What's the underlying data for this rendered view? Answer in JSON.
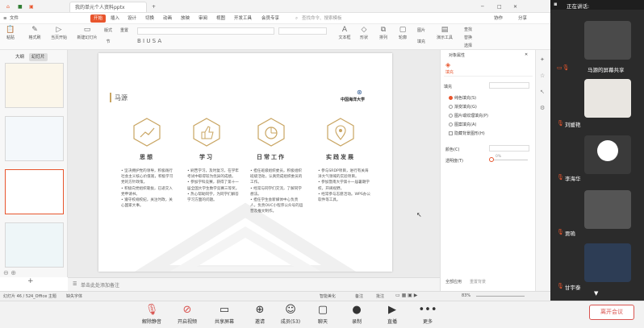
{
  "window": {
    "tabs": [
      "",
      "我的单元个人资料pptx",
      ""
    ],
    "share_banner": "正在讲话:"
  },
  "menu": {
    "items": [
      "文件",
      "开始",
      "插入",
      "设计",
      "切换",
      "动画",
      "放映",
      "审阅",
      "视图",
      "开发工具",
      "会员专享"
    ],
    "active": "开始",
    "search": "查找命令、搜索模板",
    "right": [
      "协作",
      "分享"
    ]
  },
  "ribbon": {
    "groups": [
      "粘贴",
      "格式刷",
      "当页开始",
      "新建幻灯片",
      "版式",
      "节",
      "重置",
      "文本框",
      "形状",
      "排列",
      "轮廓",
      "图片",
      "填充",
      "演示工具",
      "查找",
      "替换",
      "选择"
    ]
  },
  "left": {
    "tabs": [
      "大纲",
      "幻灯片"
    ],
    "slides": [
      "",
      "",
      "",
      "",
      ""
    ]
  },
  "slide": {
    "header": "马源",
    "logo": "中国海洋大学",
    "columns": [
      {
        "title": "思想",
        "text": "• 坚决拥护党的领导，积极践行社会主义核心价值观，积极学习党的方针政策。\n• 积极向党组织靠拢，已递交入党申请书。\n• 遵守校规校纪，关注时政，关心国家大事。"
      },
      {
        "title": "学习",
        "text": "• 刷苦学习，及时复习，在学年考试中取得较为优异的成绩。\n• 参加学科竞赛，获得了第十一届全国大学生数学竞赛三等奖。\n• 热心帮助同学，为同学们解答学习方面的问题。"
      },
      {
        "title": "日常工作",
        "text": "• 担任班级组织委员，积极组织班级活动，认真完成组织委员的工作。\n• 经常与同学们交流，了解同学想法。\n• 担任学生会新媒体中心负责人，负责OUC小程序公众号的运营及推文制作。"
      },
      {
        "title": "实践发展",
        "text": "• 参与SRDP项目，进行有关海洋大气领域的实验项目。\n• 参加暨南大学第十一届暑期学校，开阔视野。\n• 经常参与志愿活动。WPS办公软件等工具。"
      }
    ]
  },
  "rightpane": {
    "title": "对象属性",
    "tab": "填充",
    "section": "填充",
    "options": [
      "纯色填充(S)",
      "渐变填充(G)",
      "图片或纹理填充(P)",
      "图案填充(A)",
      "隐藏背景图形(H)"
    ],
    "color_label": "颜色(C)",
    "transparency_label": "透明度(T)",
    "transparency_value": "0%",
    "footer": [
      "全部应用",
      "重置背景"
    ]
  },
  "notes": {
    "placeholder": "单击此处添加备注"
  },
  "status": {
    "slide_count": "幻灯片 46 / 52",
    "theme": "4_Office 主题",
    "font_missing": "缺失字体",
    "smart_beautify": "智能美化",
    "notes_btn": "备注",
    "comment_btn": "批注",
    "zoom": "83%"
  },
  "meeting": {
    "buttons": [
      "解除静音",
      "开启视频",
      "共享屏幕",
      "邀请",
      "成员(53)",
      "聊天",
      "录制",
      "直播",
      "更多"
    ],
    "leave": "离开会议"
  },
  "video": {
    "participants": [
      "马源的屏幕共享",
      "刘媛艳",
      "李海华",
      "贾瑦",
      "甘宇泰"
    ]
  }
}
